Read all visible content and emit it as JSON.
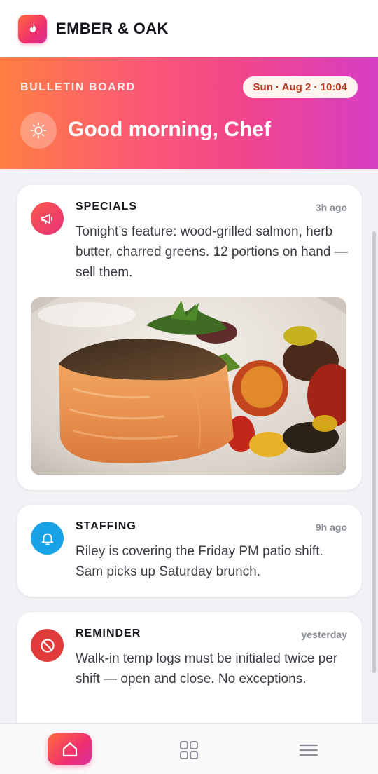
{
  "app": {
    "brand": "EMBER & OAK",
    "logo_icon": "flame-icon"
  },
  "hero": {
    "label": "BULLETIN BOARD",
    "datetime": "Sun · Aug 2 · 10:04",
    "greeting": "Good morning, Chef",
    "greeting_icon": "sun-icon"
  },
  "posts": [
    {
      "title": "SPECIALS",
      "time": "3h ago",
      "body": "Tonight’s feature: wood-grilled salmon, herb butter, charred greens. 12 portions on hand — sell them.",
      "icon": "megaphone-icon",
      "icon_color": "#f0306e",
      "has_image": true,
      "image_subject": "grilled-salmon-photo"
    },
    {
      "title": "STAFFING",
      "time": "9h ago",
      "body": "Riley is covering the Friday PM patio shift. Sam picks up Saturday brunch.",
      "icon": "bell-icon",
      "icon_color": "#19a3e6"
    },
    {
      "title": "REMINDER",
      "time": "yesterday",
      "body": "Walk-in temp logs must be initialed twice per shift — open and close. No exceptions.",
      "icon": "prohibited-icon",
      "icon_color": "#e03c3c"
    }
  ],
  "nav": {
    "items": [
      "home-icon",
      "grid-icon",
      "menu-icon"
    ],
    "active": "home-icon"
  },
  "colors": {
    "accent_start": "#ff7f42",
    "accent_mid": "#f24788",
    "accent_end": "#d73ec4",
    "date_text": "#b3361c"
  }
}
